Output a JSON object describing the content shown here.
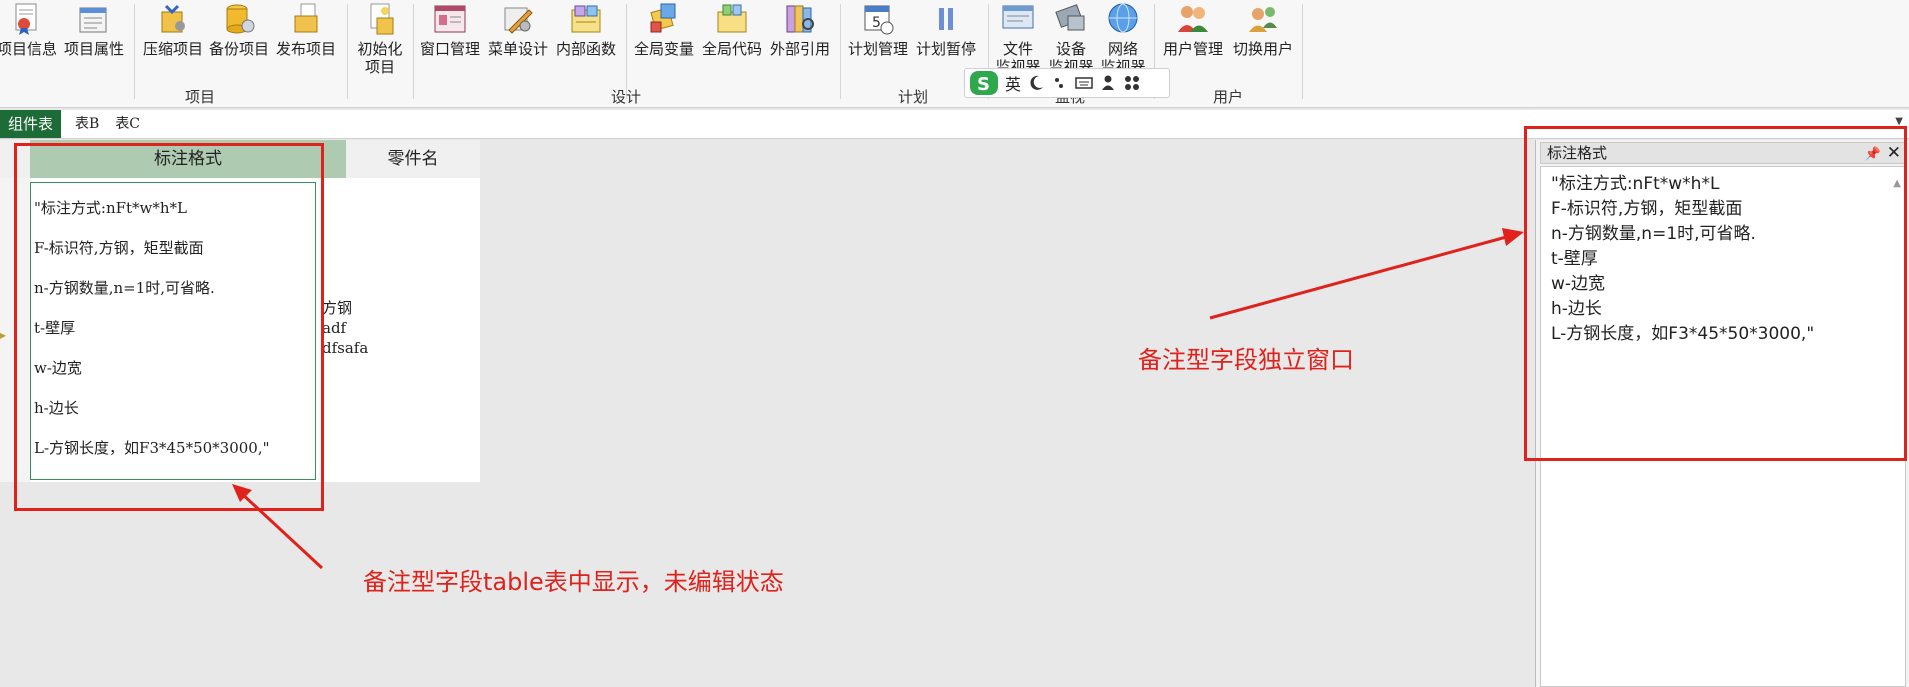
{
  "ribbon": {
    "buttons": [
      {
        "label": "项目信息",
        "icon": "certificate-icon"
      },
      {
        "label": "项目属性",
        "icon": "properties-icon"
      },
      {
        "label": "压缩项目",
        "icon": "compress-icon"
      },
      {
        "label": "备份项目",
        "icon": "backup-icon"
      },
      {
        "label": "发布项目",
        "icon": "publish-icon"
      },
      {
        "label": "初始化\n项目",
        "icon": "initialize-icon"
      },
      {
        "label": "窗口管理",
        "icon": "window-manage-icon"
      },
      {
        "label": "菜单设计",
        "icon": "menu-design-icon"
      },
      {
        "label": "内部函数",
        "icon": "function-icon"
      },
      {
        "label": "全局变量",
        "icon": "global-variable-icon"
      },
      {
        "label": "全局代码",
        "icon": "global-code-icon"
      },
      {
        "label": "外部引用",
        "icon": "external-ref-icon"
      },
      {
        "label": "计划管理",
        "icon": "calendar-icon"
      },
      {
        "label": "计划暂停",
        "icon": "pause-icon"
      },
      {
        "label": "文件\n监视器",
        "icon": "file-monitor-icon"
      },
      {
        "label": "设备\n监视器",
        "icon": "device-monitor-icon"
      },
      {
        "label": "网络\n监视器",
        "icon": "network-monitor-icon"
      },
      {
        "label": "用户管理",
        "icon": "users-icon"
      },
      {
        "label": "切换用户",
        "icon": "switch-user-icon"
      }
    ],
    "groups": [
      "项目",
      "设计",
      "计划",
      "监视",
      "用户"
    ],
    "ime": {
      "lang": "英"
    }
  },
  "tabs": [
    {
      "label": "组件表",
      "active": true
    },
    {
      "label": "表B",
      "active": false
    },
    {
      "label": "表C",
      "active": false
    }
  ],
  "grid": {
    "columns": [
      "标注格式",
      "零件名"
    ],
    "popup_lines": [
      "\"标注方式:nFt*w*h*L",
      "F-标识符,方钢，矩型截面",
      "n-方钢数量,n=1时,可省略.",
      "t-壁厚",
      "w-边宽",
      "h-边长",
      "L-方钢长度，如F3*45*50*3000,\""
    ],
    "side_values": [
      "方钢",
      "adf",
      "dfsafa"
    ]
  },
  "memo_window": {
    "title": "标注格式",
    "lines": [
      "\"标注方式:nFt*w*h*L",
      "F-标识符,方钢，矩型截面",
      "n-方钢数量,n=1时,可省略.",
      "t-壁厚",
      "w-边宽",
      "h-边长",
      "L-方钢长度，如F3*45*50*3000,\""
    ]
  },
  "annotations": {
    "table_note": "备注型字段table表中显示，未编辑状态",
    "window_note": "备注型字段独立窗口"
  },
  "colors": {
    "accent_green": "#1d6b36",
    "annotation_red": "#e0221c",
    "selected_header": "#aecbb1"
  }
}
